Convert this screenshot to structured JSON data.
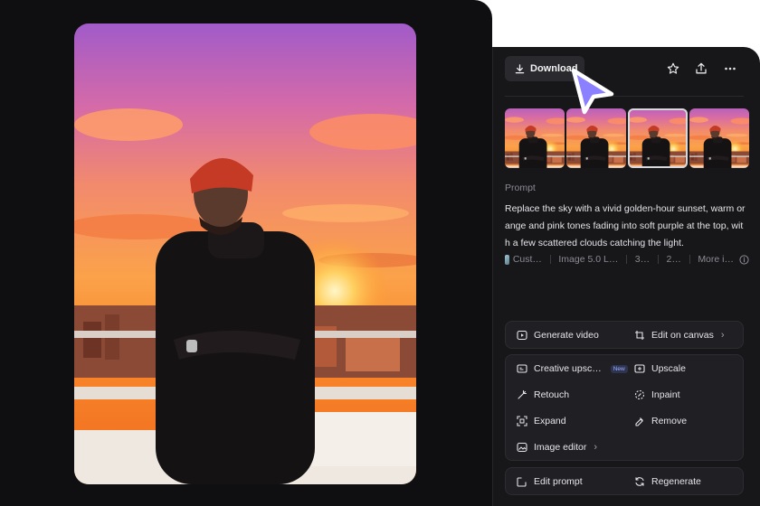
{
  "toolbar": {
    "download_label": "Download",
    "icons": [
      "star-icon",
      "share-icon",
      "more-icon"
    ]
  },
  "thumbnails": {
    "count": 4,
    "selected_index": 2
  },
  "prompt": {
    "label": "Prompt",
    "text": "Replace the sky with a vivid golden-hour sunset, warm orange and pink tones fading into soft purple at the top, with a few scattered clouds catching the light."
  },
  "meta": {
    "style": "Cust…",
    "model": "Image 5.0 L…",
    "ratio": "3…",
    "count": "2…",
    "more": "More i…"
  },
  "actions": {
    "generate_video": "Generate video",
    "edit_on_canvas": "Edit on canvas",
    "creative_upscale": "Creative upsc…",
    "new_badge": "New",
    "upscale": "Upscale",
    "retouch": "Retouch",
    "inpaint": "Inpaint",
    "expand": "Expand",
    "remove": "Remove",
    "image_editor": "Image editor",
    "edit_prompt": "Edit prompt",
    "regenerate": "Regenerate"
  },
  "colors": {
    "canvas_bg": "#0f0f11",
    "panel_bg": "#17171a",
    "button_bg": "#2a2a2e",
    "cursor": "#8b80ff"
  }
}
